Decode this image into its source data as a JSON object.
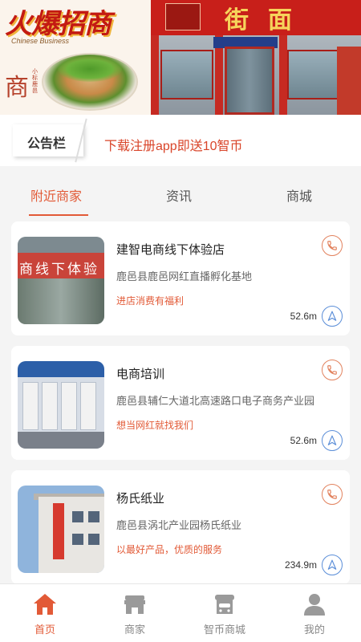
{
  "banner": {
    "promo_title": "火爆招商",
    "promo_subtitle": "Chinese Business",
    "seal_char": "商",
    "seal_vertical": "小标鹿邑",
    "shop_sign": "街面"
  },
  "notice": {
    "label": "公告栏",
    "text": "下载注册app即送10智币"
  },
  "tabs": [
    {
      "label": "附近商家",
      "active": true
    },
    {
      "label": "资讯",
      "active": false
    },
    {
      "label": "商城",
      "active": false
    }
  ],
  "merchants": [
    {
      "name": "建智电商线下体验店",
      "address": "鹿邑县鹿邑网红直播孵化基地",
      "slogan": "进店消费有福利",
      "distance": "52.6m",
      "thumb_sign": "商线下体验"
    },
    {
      "name": "电商培训",
      "address": "鹿邑县辅仁大道北高速路口电子商务产业园",
      "slogan": "想当网红就找我们",
      "distance": "52.6m"
    },
    {
      "name": "杨氏纸业",
      "address": "鹿邑县涡北产业园杨氏纸业",
      "slogan": "以最好产品，优质的服务",
      "distance": "234.9m"
    }
  ],
  "bottom_nav": [
    {
      "label": "首页",
      "icon": "home-icon",
      "active": true
    },
    {
      "label": "商家",
      "icon": "store-icon",
      "active": false
    },
    {
      "label": "智币商城",
      "icon": "mall-icon",
      "active": false
    },
    {
      "label": "我的",
      "icon": "user-icon",
      "active": false
    }
  ],
  "colors": {
    "accent": "#e25a37",
    "nav_blue": "#5b8ed8",
    "background": "#f4f4f4"
  }
}
